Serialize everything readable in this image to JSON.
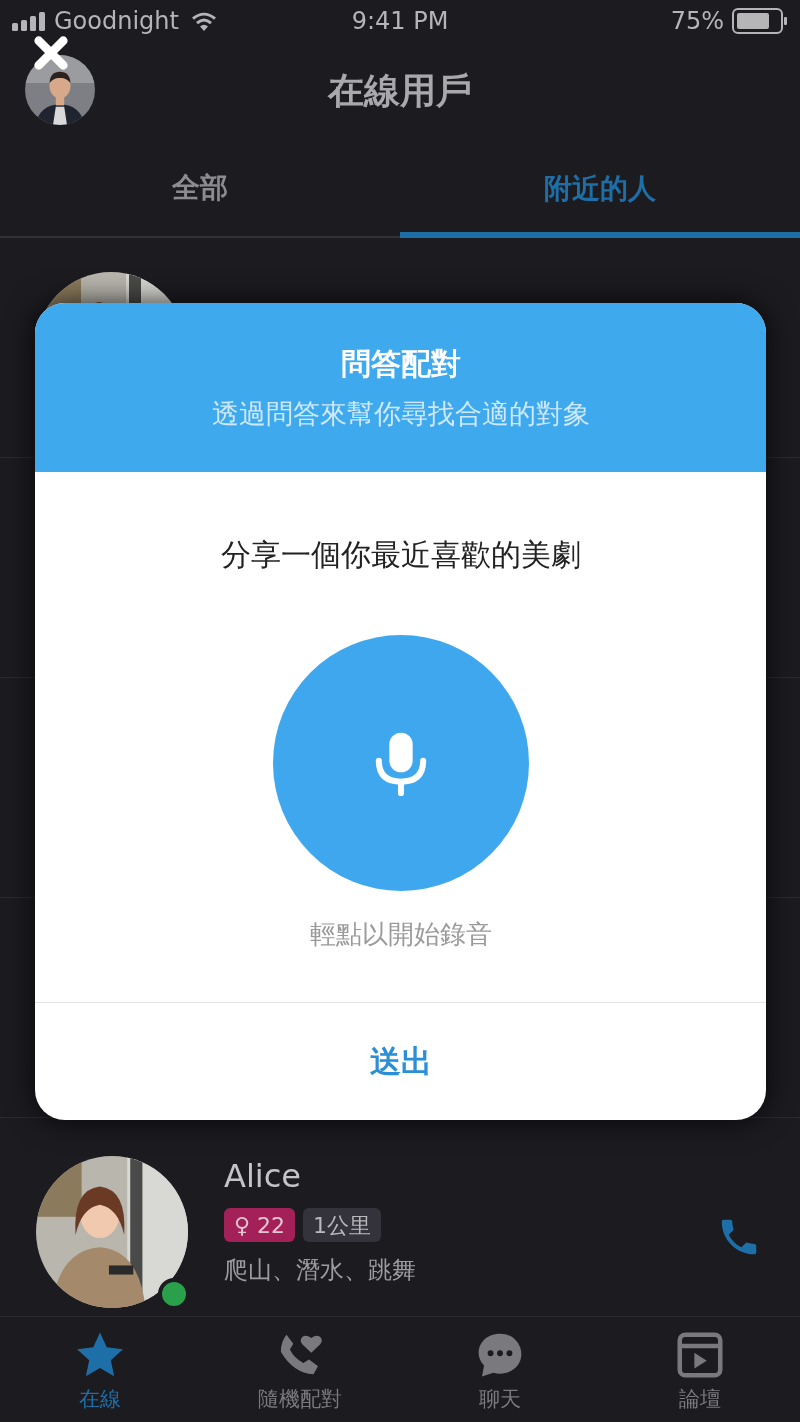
{
  "status_bar": {
    "carrier": "Goodnight",
    "time": "9:41 PM",
    "battery": "75%"
  },
  "header": {
    "title": "在線用戶"
  },
  "tabs": [
    {
      "label": "全部",
      "selected": false
    },
    {
      "label": "附近的人",
      "selected": true
    }
  ],
  "users": [
    {
      "name": "Alice",
      "age": "♀ 22",
      "distance": "1公里",
      "interests": "爬山、潛水、跳舞",
      "online": true
    }
  ],
  "dialog": {
    "title": "問答配對",
    "subtitle": "透過問答來幫你尋找合適的對象",
    "question": "分享一個你最近喜歡的美劇",
    "hint": "輕點以開始錄音",
    "button": "送出"
  },
  "nav": [
    {
      "kind": "star",
      "label": "在線",
      "selected": true
    },
    {
      "kind": "call",
      "label": "隨機配對",
      "selected": false
    },
    {
      "kind": "chat",
      "label": "聊天",
      "selected": false
    },
    {
      "kind": "forum",
      "label": "論壇",
      "selected": false
    }
  ]
}
